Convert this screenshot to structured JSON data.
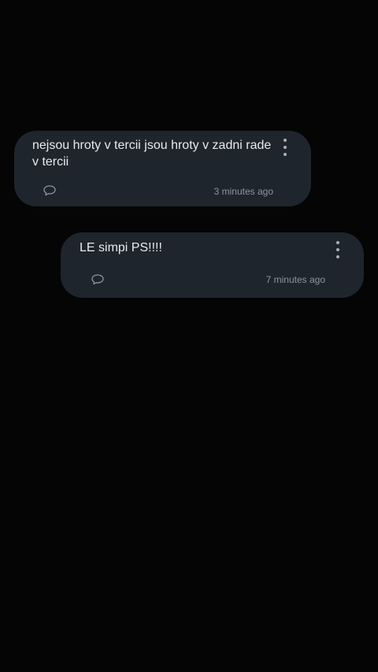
{
  "comments": [
    {
      "text": "nejsou hroty v tercii jsou hroty v zadni rade v tercii",
      "timestamp": "3 minutes ago",
      "reply_icon": "speech-bubble-icon",
      "menu_icon": "more-vertical-icon"
    },
    {
      "text": "LE simpi PS!!!!",
      "timestamp": "7 minutes ago",
      "reply_icon": "speech-bubble-icon",
      "menu_icon": "more-vertical-icon"
    }
  ],
  "colors": {
    "background": "#050505",
    "bubble": "#1f252d",
    "text": "#e8eaed",
    "muted": "#8e959c"
  }
}
